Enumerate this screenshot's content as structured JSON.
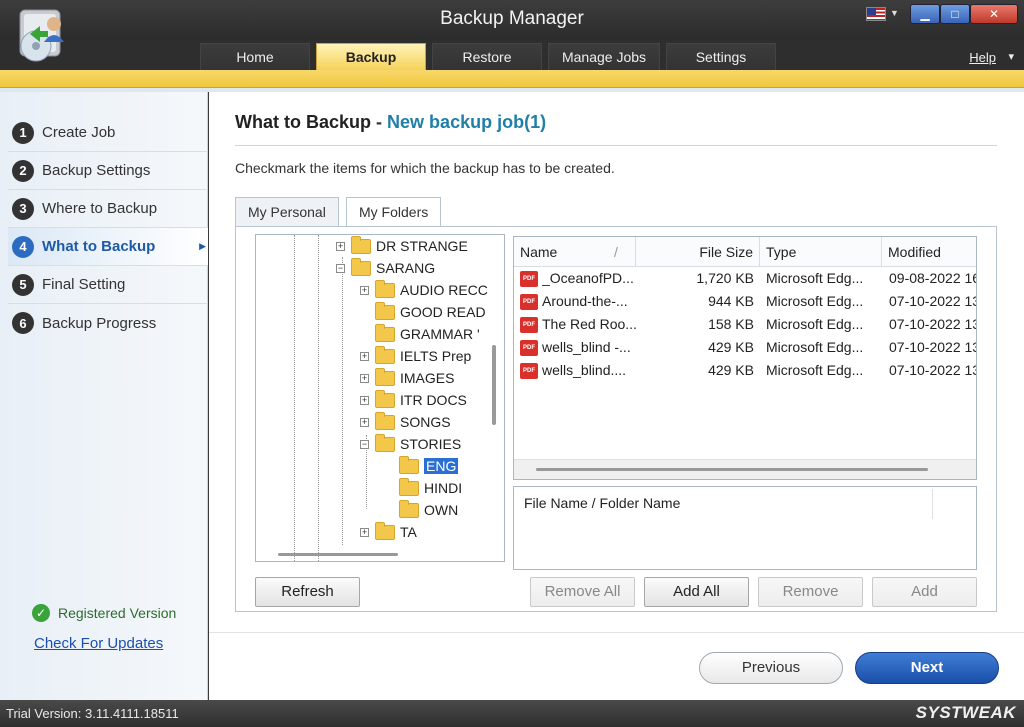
{
  "app": {
    "title": "Backup Manager",
    "help_label": "Help",
    "version": "Trial Version: 3.11.4111.18511",
    "brand": "SYSTWEAK"
  },
  "nav_tabs": [
    {
      "label": "Home"
    },
    {
      "label": "Backup"
    },
    {
      "label": "Restore"
    },
    {
      "label": "Manage Jobs"
    },
    {
      "label": "Settings"
    }
  ],
  "steps": [
    {
      "num": "1",
      "label": "Create Job"
    },
    {
      "num": "2",
      "label": "Backup Settings"
    },
    {
      "num": "3",
      "label": "Where to Backup"
    },
    {
      "num": "4",
      "label": "What to Backup"
    },
    {
      "num": "5",
      "label": "Final Setting"
    },
    {
      "num": "6",
      "label": "Backup Progress"
    }
  ],
  "sidebar": {
    "registered": "Registered Version",
    "check_updates": "Check For Updates"
  },
  "main": {
    "heading": "What to Backup",
    "heading_sep": "-",
    "job_name": "New backup job(1)",
    "instruction": "Checkmark the items for which the backup has to be created.",
    "subtabs": [
      {
        "label": "My Personal"
      },
      {
        "label": "My Folders"
      }
    ]
  },
  "tree": [
    {
      "label": "DR STRANGE"
    },
    {
      "label": "SARANG"
    },
    {
      "label": "AUDIO RECC"
    },
    {
      "label": "GOOD READ"
    },
    {
      "label": "GRAMMAR '"
    },
    {
      "label": "IELTS Prep"
    },
    {
      "label": "IMAGES"
    },
    {
      "label": "ITR DOCS"
    },
    {
      "label": "SONGS"
    },
    {
      "label": "STORIES"
    },
    {
      "label": "ENG"
    },
    {
      "label": "HINDI"
    },
    {
      "label": "OWN"
    },
    {
      "label": "TA"
    }
  ],
  "file_list": {
    "columns": {
      "name": "Name",
      "sort": "/",
      "size": "File Size",
      "type": "Type",
      "modified": "Modified"
    },
    "rows": [
      {
        "icon": "PDF",
        "name": "_OceanofPD...",
        "size": "1,720 KB",
        "type": "Microsoft Edg...",
        "modified": "09-08-2022 16"
      },
      {
        "icon": "PDF",
        "name": "Around-the-...",
        "size": "944 KB",
        "type": "Microsoft Edg...",
        "modified": "07-10-2022 13"
      },
      {
        "icon": "PDF",
        "name": "The Red Roo...",
        "size": "158 KB",
        "type": "Microsoft Edg...",
        "modified": "07-10-2022 13"
      },
      {
        "icon": "PDF",
        "name": "wells_blind -...",
        "size": "429 KB",
        "type": "Microsoft Edg...",
        "modified": "07-10-2022 13"
      },
      {
        "icon": "PDF",
        "name": "wells_blind....",
        "size": "429 KB",
        "type": "Microsoft Edg...",
        "modified": "07-10-2022 13"
      }
    ]
  },
  "name_box": {
    "label": "File Name / Folder Name"
  },
  "buttons": {
    "refresh": "Refresh",
    "remove_all": "Remove All",
    "add_all": "Add All",
    "remove": "Remove",
    "add": "Add",
    "previous": "Previous",
    "next": "Next"
  }
}
